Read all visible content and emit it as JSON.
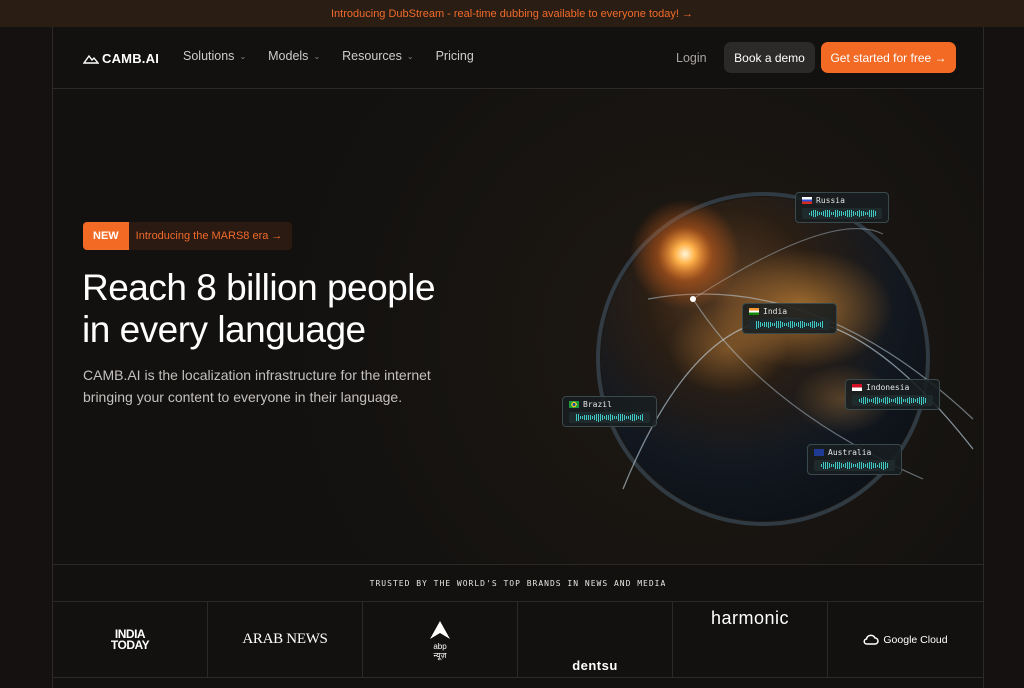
{
  "announcement": {
    "text": "Introducing DubStream - real-time dubbing available to everyone today! →"
  },
  "nav": {
    "logo": "CAMB.AI",
    "menu": [
      {
        "label": "Solutions",
        "has_dropdown": true
      },
      {
        "label": "Models",
        "has_dropdown": true
      },
      {
        "label": "Resources",
        "has_dropdown": true
      },
      {
        "label": "Pricing",
        "has_dropdown": false
      }
    ],
    "login": "Login",
    "demo": "Book a demo",
    "start": "Get started for free →",
    "accent": "#f36a25"
  },
  "hero": {
    "badge_new": "NEW",
    "badge_text": "Introducing the MARS8 era →",
    "headline_line1": "Reach 8 billion people",
    "headline_line2": "in every language",
    "subtitle": "CAMB.AI is the localization infrastructure for the internet bringing your content to everyone in their language."
  },
  "languages": [
    "Russia",
    "India",
    "Indonesia",
    "Brazil",
    "Australia"
  ],
  "trusted": {
    "label": "TRUSTED BY THE WORLD'S TOP BRANDS IN NEWS AND MEDIA"
  },
  "brands": {
    "india_today_line1": "INDIA",
    "india_today_line2": "TODAY",
    "arab_news": "ARAB NEWS",
    "abp_line1": "abp",
    "abp_line2": "न्यूज़",
    "dentsu": "dentsu",
    "harmonic": "harmonic",
    "google_cloud": "Google Cloud"
  }
}
